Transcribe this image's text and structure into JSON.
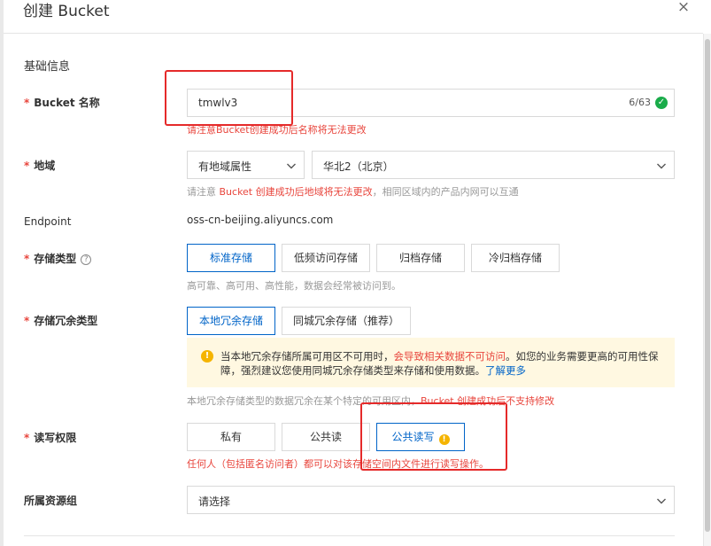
{
  "dialog": {
    "title": "创建 Bucket",
    "close_icon": "×"
  },
  "section": {
    "basic_info": "基础信息"
  },
  "bucket_name": {
    "required_mark": "*",
    "label": "Bucket 名称",
    "value": "tmwlv3",
    "counter": "6/63",
    "valid_icon": "check-circle-icon",
    "hint": "请注意Bucket创建成功后名称将无法更改"
  },
  "region": {
    "required_mark": "*",
    "label": "地域",
    "attr_select": "有地域属性",
    "region_select": "华北2（北京）",
    "hint_prefix": "请注意 ",
    "hint_red": "Bucket 创建成功后地域将无法更改",
    "hint_suffix": "，相同区域内的产品内网可以互通"
  },
  "endpoint": {
    "label": "Endpoint",
    "value": "oss-cn-beijing.aliyuncs.com"
  },
  "storage_class": {
    "required_mark": "*",
    "label": "存储类型",
    "help_icon": "?",
    "options": [
      "标准存储",
      "低频访问存储",
      "归档存储",
      "冷归档存储"
    ],
    "selected_index": 0,
    "hint": "高可靠、高可用、高性能，数据会经常被访问到。"
  },
  "redundancy": {
    "required_mark": "*",
    "label": "存储冗余类型",
    "options": [
      "本地冗余存储",
      "同城冗余存储（推荐）"
    ],
    "selected_index": 0,
    "warning": {
      "icon": "!",
      "text_1": "当本地冗余存储所属可用区不可用时，",
      "text_red": "会导致相关数据不可访问",
      "text_2": "。如您的业务需要更高的可用性保障，强烈建议您使用同城冗余存储类型来存储和使用数据。",
      "link": "了解更多"
    },
    "hint_1": "本地冗余存储类型的数据冗余在某个特定的可用区内，",
    "hint_red": "Bucket 创建成功后不支持修改"
  },
  "acl": {
    "required_mark": "*",
    "label": "读写权限",
    "options": [
      "私有",
      "公共读",
      "公共读写"
    ],
    "selected_index": 2,
    "warn_icon": "!",
    "hint": "任何人（包括匿名访问者）都可以对该存储空间内文件进行读写操作。"
  },
  "resource_group": {
    "label": "所属资源组",
    "placeholder": "请选择"
  },
  "colors": {
    "primary": "#0064c8",
    "danger": "#e8453c",
    "success": "#1aac4a",
    "warning": "#f5b400",
    "annotation": "#e52a2a"
  }
}
